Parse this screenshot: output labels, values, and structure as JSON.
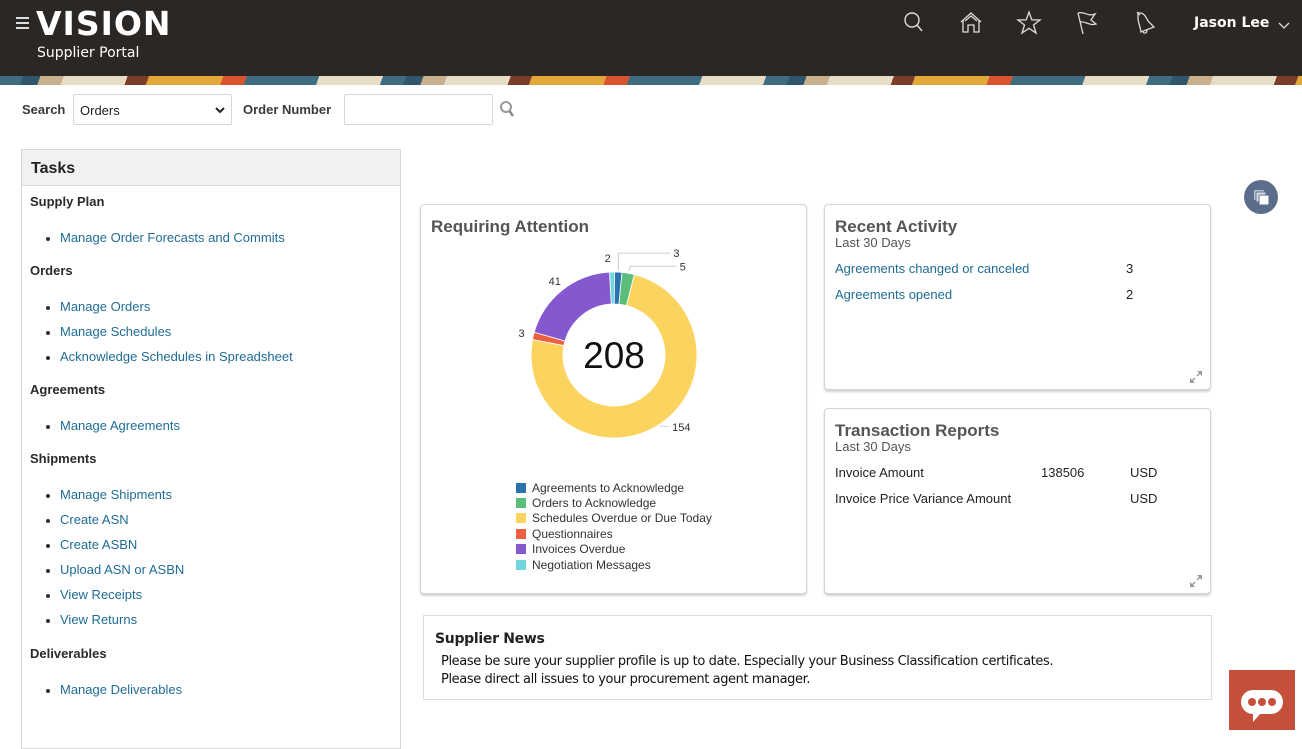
{
  "header": {
    "logo_text": "VISION",
    "subtitle": "Supplier Portal",
    "icons": [
      "search-icon",
      "home-icon",
      "favorites-star-icon",
      "watchlist-flag-icon",
      "notifications-bell-icon"
    ],
    "user_name": "Jason Lee"
  },
  "search": {
    "label": "Search",
    "category_selected": "Orders",
    "field_label": "Order Number",
    "field_value": "",
    "field_placeholder": ""
  },
  "tasks": {
    "title": "Tasks",
    "groups": [
      {
        "title": "Supply Plan",
        "items": [
          "Manage Order Forecasts and Commits"
        ]
      },
      {
        "title": "Orders",
        "items": [
          "Manage Orders",
          "Manage Schedules",
          "Acknowledge Schedules in Spreadsheet"
        ]
      },
      {
        "title": "Agreements",
        "items": [
          "Manage Agreements"
        ]
      },
      {
        "title": "Shipments",
        "items": [
          "Manage Shipments",
          "Create ASN",
          "Create ASBN",
          "Upload ASN or ASBN",
          "View Receipts",
          "View Returns"
        ]
      },
      {
        "title": "Deliverables",
        "items": [
          "Manage Deliverables"
        ]
      }
    ]
  },
  "requiring_attention": {
    "title": "Requiring Attention",
    "total": "208"
  },
  "chart_data": {
    "type": "pie",
    "subtype": "donut",
    "title": "Requiring Attention",
    "center_label": "208",
    "order": "clockwise from top",
    "slices": [
      {
        "name": "Negotiation Messages",
        "value": 2,
        "color": "#6fd6de"
      },
      {
        "name": "Agreements to Acknowledge",
        "value": 3,
        "color": "#2a73b0"
      },
      {
        "name": "Orders to Acknowledge",
        "value": 5,
        "color": "#5bbd7a"
      },
      {
        "name": "Schedules Overdue or Due Today",
        "value": 154,
        "color": "#fad45f"
      },
      {
        "name": "Questionnaires",
        "value": 3,
        "color": "#ec6041"
      },
      {
        "name": "Invoices Overdue",
        "value": 41,
        "color": "#8458cf"
      }
    ],
    "legend": [
      {
        "name": "Agreements to Acknowledge",
        "color": "#2a73b0"
      },
      {
        "name": "Orders to Acknowledge",
        "color": "#5bbd7a"
      },
      {
        "name": "Schedules Overdue or Due Today",
        "color": "#fad45f"
      },
      {
        "name": "Questionnaires",
        "color": "#ec6041"
      },
      {
        "name": "Invoices Overdue",
        "color": "#8458cf"
      },
      {
        "name": "Negotiation Messages",
        "color": "#6fd6de"
      }
    ],
    "legend_position": "bottom"
  },
  "recent_activity": {
    "title": "Recent Activity",
    "subtitle": "Last 30 Days",
    "rows": [
      {
        "label": "Agreements changed or canceled",
        "value": "3"
      },
      {
        "label": "Agreements opened",
        "value": "2"
      }
    ]
  },
  "transaction_reports": {
    "title": "Transaction Reports",
    "subtitle": "Last 30 Days",
    "rows": [
      {
        "label": "Invoice Amount",
        "amount": "138506",
        "currency": "USD"
      },
      {
        "label": "Invoice Price Variance Amount",
        "amount": "",
        "currency": "USD"
      }
    ]
  },
  "supplier_news": {
    "title": "Supplier News",
    "lines": [
      "Please be sure your supplier profile is up to date.  Especially your Business Classification certificates.",
      "Please direct all issues to your procurement agent manager."
    ]
  },
  "colors": {
    "header_bg": "#2b2724",
    "link": "#1f6c96",
    "chat_button": "#c4503c",
    "floating_button": "#5b6d8a"
  }
}
